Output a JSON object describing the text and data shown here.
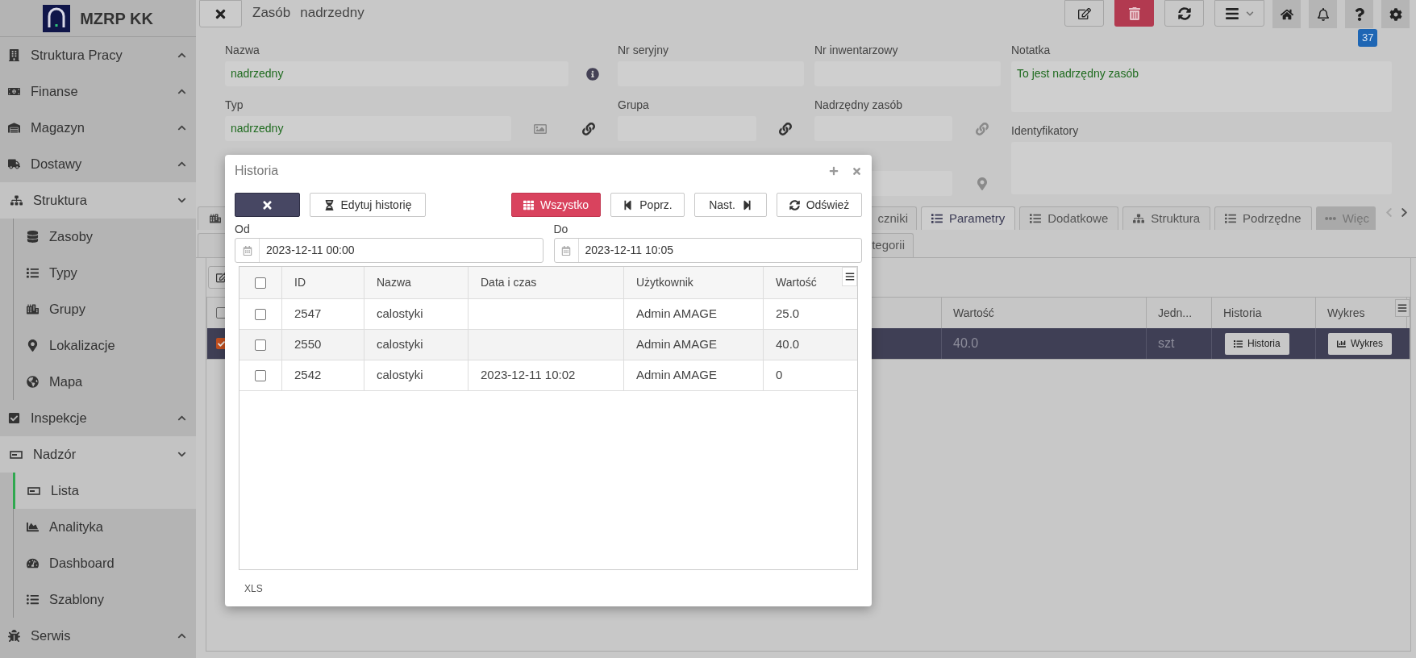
{
  "app": {
    "title": "MZRP KK"
  },
  "sidebar": {
    "items": [
      {
        "label": "Struktura Pracy",
        "expanded": false
      },
      {
        "label": "Finanse",
        "expanded": false
      },
      {
        "label": "Magazyn",
        "expanded": false
      },
      {
        "label": "Dostawy",
        "expanded": false
      },
      {
        "label": "Struktura",
        "expanded": true,
        "children": [
          {
            "label": "Zasoby",
            "selected": false
          },
          {
            "label": "Typy",
            "selected": false
          },
          {
            "label": "Grupy",
            "selected": false
          },
          {
            "label": "Lokalizacje",
            "selected": false
          },
          {
            "label": "Mapa",
            "selected": false
          }
        ]
      },
      {
        "label": "Inspekcje",
        "expanded": false
      },
      {
        "label": "Nadzór",
        "expanded": true,
        "children": [
          {
            "label": "Lista",
            "selected": true
          },
          {
            "label": "Analityka",
            "selected": false
          },
          {
            "label": "Dashboard",
            "selected": false
          },
          {
            "label": "Szablony",
            "selected": false
          }
        ]
      },
      {
        "label": "Serwis",
        "expanded": false
      }
    ]
  },
  "header": {
    "title": "Zasób",
    "subtitle": "nadrzedny",
    "toolbar": [
      {
        "kind": "edit"
      },
      {
        "kind": "delete"
      },
      {
        "kind": "refresh"
      },
      {
        "kind": "menu"
      },
      {
        "kind": "home"
      },
      {
        "kind": "notifications"
      },
      {
        "kind": "help",
        "badge": "37"
      },
      {
        "kind": "settings"
      }
    ]
  },
  "form": {
    "columns": [
      [
        {
          "label": "Nazwa",
          "value": "nadrzedny"
        },
        {
          "label": "Typ",
          "value": "nadrzedny"
        }
      ],
      [
        {
          "label": "Nr seryjny"
        },
        {
          "label": "Grupa"
        }
      ],
      [
        {
          "label": "Nr inwentarzowy"
        },
        {
          "label": "Nadrzędny zasób"
        },
        {}
      ],
      [
        {
          "label": "Notatka",
          "value": "To jest nadrzędny zasób"
        },
        {
          "label": "Identyfikatory"
        }
      ]
    ]
  },
  "tabs": [
    {
      "label": "czniki",
      "selected": false,
      "kind": "tab"
    },
    {
      "label": "Parametry",
      "selected": true,
      "kind": "tab"
    },
    {
      "label": "Dodatkowe",
      "selected": false,
      "kind": "tab"
    },
    {
      "label": "Struktura",
      "selected": false,
      "kind": "tab"
    },
    {
      "label": "Podrzędne",
      "selected": false,
      "kind": "tab"
    },
    {
      "label": "Więc",
      "selected": false,
      "kind": "more"
    }
  ],
  "tabs_row_2": [
    {
      "label": "tegorii",
      "selected": false
    }
  ],
  "parameters_table": {
    "all_checked": false,
    "columns": [
      "Wartość",
      "Jedn...",
      "Historia",
      "Wykres"
    ],
    "rows": [
      {
        "checked": true,
        "selected": true,
        "value": "40.0",
        "unit": "szt",
        "history_button": "Historia",
        "chart_button": "Wykres"
      }
    ]
  },
  "dialog": {
    "title": "Historia",
    "toolbar": [
      {
        "kind": "close"
      },
      {
        "kind": "edit",
        "label": "Edytuj historię"
      },
      {
        "kind": "all",
        "label": "Wszystko"
      },
      {
        "kind": "prev",
        "label": "Poprz."
      },
      {
        "kind": "next",
        "label": "Nast."
      },
      {
        "kind": "refresh",
        "label": "Odśwież"
      }
    ],
    "date_range": [
      {
        "label": "Od",
        "value": "2023-12-11 00:00"
      },
      {
        "label": "Do",
        "value": "2023-12-11 10:05"
      }
    ],
    "table": {
      "all_checked": false,
      "columns": [
        "ID",
        "Nazwa",
        "Data i czas",
        "Użytkownik",
        "Wartość"
      ],
      "rows": [
        {
          "checked": false,
          "cells": [
            "2547",
            "calostyki",
            "",
            "Admin AMAGE",
            "25.0"
          ]
        },
        {
          "checked": false,
          "cells": [
            "2550",
            "calostyki",
            "",
            "Admin AMAGE",
            "40.0"
          ]
        },
        {
          "checked": false,
          "cells": [
            "2542",
            "calostyki",
            "2023-12-11 10:02",
            "Admin AMAGE",
            "0"
          ]
        }
      ]
    },
    "footer": "XLS"
  }
}
